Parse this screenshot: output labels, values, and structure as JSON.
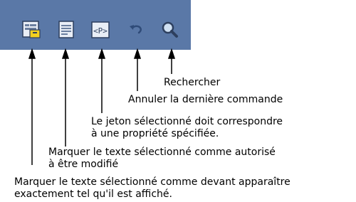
{
  "toolbar": {
    "buttons": [
      {
        "icon": "locked-text-icon",
        "tooltip": "Marquer le texte sélectionné comme devant apparaître exactement tel qu'il est affiché."
      },
      {
        "icon": "editable-text-icon",
        "tooltip": "Marquer le texte sélectionné comme autorisé à être modifié"
      },
      {
        "icon": "property-token-icon",
        "tooltip": "Le jeton sélectionné doit correspondre à une propriété spécifiée."
      },
      {
        "icon": "undo-icon",
        "tooltip": "Annuler la dernière commande"
      },
      {
        "icon": "search-icon",
        "tooltip": "Rechercher"
      }
    ]
  },
  "callouts": {
    "search": [
      "Rechercher"
    ],
    "undo": [
      "Annuler la dernière commande"
    ],
    "property": [
      "Le jeton sélectionné doit correspondre",
      "à une propriété spécifiée."
    ],
    "editable": [
      "Marquer le texte sélectionné comme autorisé",
      "à être modifié"
    ],
    "locked": [
      "Marquer le texte sélectionné comme devant apparaître",
      "exactement tel qu'il est affiché."
    ]
  },
  "icon_glyphs": {
    "property": "<P>"
  },
  "colors": {
    "toolbar": "#5a78a7",
    "icon_yellow": "#f2d020",
    "icon_light": "#e6eef8"
  }
}
